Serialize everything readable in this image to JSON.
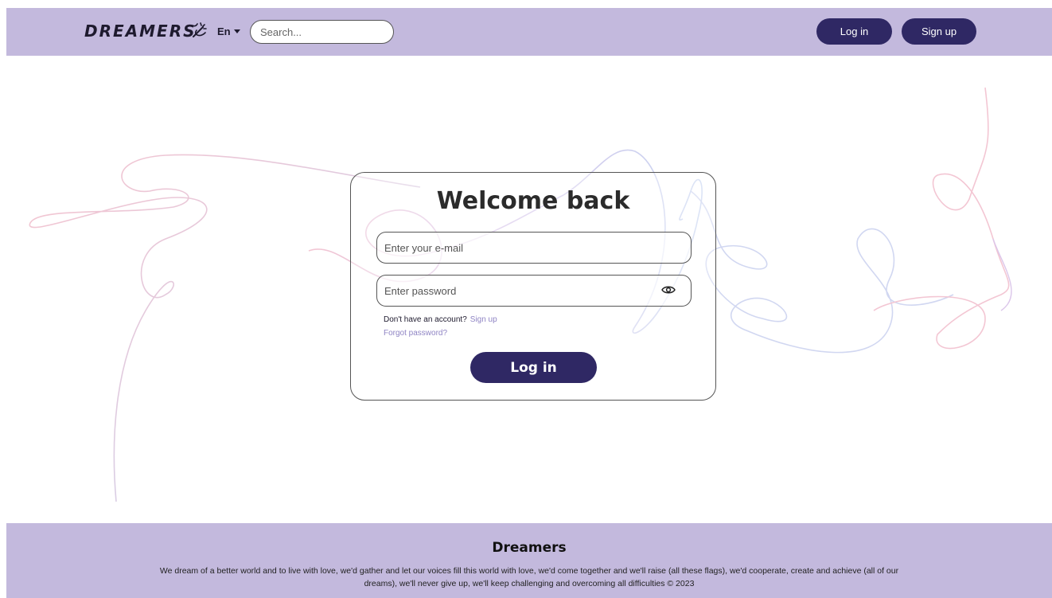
{
  "header": {
    "logo": "DREAMERS",
    "language": "En",
    "search_placeholder": "Search...",
    "login_label": "Log in",
    "signup_label": "Sign up"
  },
  "card": {
    "title": "Welcome back",
    "email_placeholder": "Enter your e-mail",
    "password_placeholder": "Enter password",
    "no_account_text": "Don't have an account?",
    "signup_link": "Sign up",
    "forgot_link": "Forgot password?",
    "login_button": "Log in"
  },
  "footer": {
    "title": "Dreamers",
    "text": "We dream of a better world and to live with love, we'd gather and let our voices fill this world with love, we'd come together and we'll raise (all these flags), we'd cooperate, create and achieve (all of our dreams), we'll never give up, we'll keep challenging and overcoming all difficulties © 2023"
  },
  "colors": {
    "header_bg": "#c3b9dd",
    "accent": "#2f2864",
    "link": "#8f84c4"
  },
  "icons": [
    "magic-wand-icon",
    "caret-down-icon",
    "eye-icon"
  ]
}
